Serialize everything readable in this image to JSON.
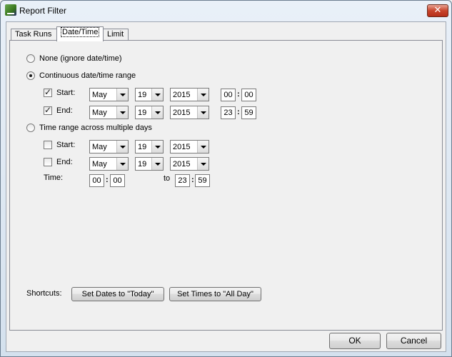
{
  "window": {
    "title": "Report Filter",
    "close_label": "✕"
  },
  "tabs": [
    "Task Runs",
    "Date/Time",
    "Limit"
  ],
  "options": {
    "none_label": "None (ignore date/time)",
    "continuous_label": "Continuous date/time range",
    "multi_label": "Time range across multiple days"
  },
  "continuous": {
    "start_label": "Start:",
    "end_label": "End:",
    "start": {
      "month": "May",
      "day": "19",
      "year": "2015",
      "hour": "00",
      "minute": "00"
    },
    "end": {
      "month": "May",
      "day": "19",
      "year": "2015",
      "hour": "23",
      "minute": "59"
    }
  },
  "multi": {
    "start_label": "Start:",
    "end_label": "End:",
    "time_label": "Time:",
    "to_label": "to",
    "start": {
      "month": "May",
      "day": "19",
      "year": "2015"
    },
    "end": {
      "month": "May",
      "day": "19",
      "year": "2015"
    },
    "time_from": {
      "hour": "00",
      "minute": "00"
    },
    "time_to": {
      "hour": "23",
      "minute": "59"
    }
  },
  "shortcuts": {
    "label": "Shortcuts:",
    "today_button": "Set Dates to \"Today\"",
    "allday_button": "Set Times to \"All Day\""
  },
  "footer": {
    "ok_label": "OK",
    "cancel_label": "Cancel"
  }
}
